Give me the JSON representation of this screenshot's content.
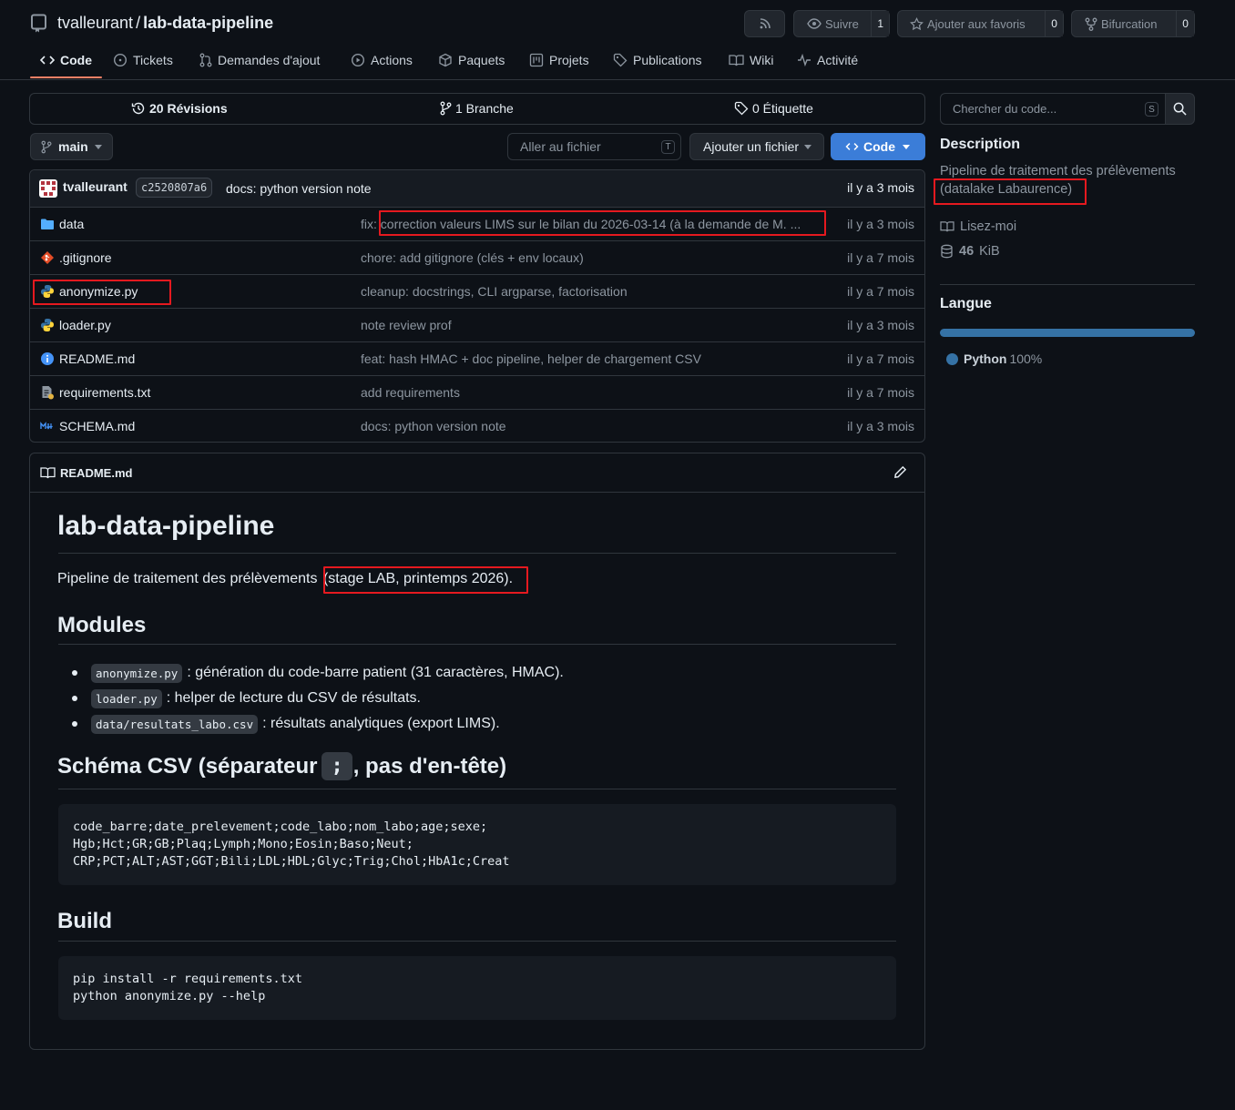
{
  "repo": {
    "owner": "tvalleurant",
    "separator": "/",
    "name": "lab-data-pipeline"
  },
  "header_buttons": {
    "watch_label": "Suivre",
    "watch_count": "1",
    "star_label": "Ajouter aux favoris",
    "star_count": "0",
    "fork_label": "Bifurcation",
    "fork_count": "0"
  },
  "nav": [
    {
      "label": "Code",
      "icon": "code-icon"
    },
    {
      "label": "Tickets",
      "icon": "issue-icon"
    },
    {
      "label": "Demandes d'ajout",
      "icon": "pull-request-icon"
    },
    {
      "label": "Actions",
      "icon": "play-icon"
    },
    {
      "label": "Paquets",
      "icon": "package-icon"
    },
    {
      "label": "Projets",
      "icon": "project-icon"
    },
    {
      "label": "Publications",
      "icon": "tag-icon"
    },
    {
      "label": "Wiki",
      "icon": "book-icon"
    },
    {
      "label": "Activité",
      "icon": "pulse-icon"
    }
  ],
  "stats": {
    "commits": "20 Révisions",
    "branches": "1 Branche",
    "tags": "0 Étiquette"
  },
  "branch": "main",
  "goto_file_placeholder": "Aller au fichier",
  "goto_file_key": "T",
  "add_file_label": "Ajouter un fichier",
  "code_button_label": "Code",
  "latest_commit": {
    "author": "tvalleurant",
    "hash": "c2520807a6",
    "message": "docs: python version note",
    "date": "il y a 3 mois"
  },
  "files": [
    {
      "name": "data",
      "type": "folder",
      "message": "fix: correction valeurs LIMS sur le bilan du 2026-03-14 (à la demande de M. ...",
      "date": "il y a 3 mois"
    },
    {
      "name": ".gitignore",
      "type": "git",
      "message": "chore: add gitignore (clés + env locaux)",
      "date": "il y a 7 mois"
    },
    {
      "name": "anonymize.py",
      "type": "python",
      "message": "cleanup: docstrings, CLI argparse, factorisation",
      "date": "il y a 7 mois"
    },
    {
      "name": "loader.py",
      "type": "python",
      "message": "note review prof",
      "date": "il y a 3 mois"
    },
    {
      "name": "README.md",
      "type": "info",
      "message": "feat: hash HMAC + doc pipeline, helper de chargement CSV",
      "date": "il y a 7 mois"
    },
    {
      "name": "requirements.txt",
      "type": "text",
      "message": "add requirements",
      "date": "il y a 7 mois"
    },
    {
      "name": "SCHEMA.md",
      "type": "markdown",
      "message": "docs: python version note",
      "date": "il y a 3 mois"
    }
  ],
  "readme": {
    "tab_label": "README.md",
    "h1": "lab-data-pipeline",
    "intro_a": "Pipeline de traitement des prélèvements",
    "intro_b": "(stage LAB, printemps 2026).",
    "h2_modules": "Modules",
    "modules": [
      {
        "code": "anonymize.py",
        "text": ": génération du code-barre patient (31 caractères, HMAC)."
      },
      {
        "code": "loader.py",
        "text": ": helper de lecture du CSV de résultats."
      },
      {
        "code": "data/resultats_labo.csv",
        "text": ": résultats analytiques (export LIMS)."
      }
    ],
    "h2_schema_a": "Schéma CSV (séparateur",
    "h2_schema_code": ";",
    "h2_schema_b": ", pas d'en-tête)",
    "schema_lines": [
      "code_barre;date_prelevement;code_labo;nom_labo;age;sexe;",
      "Hgb;Hct;GR;GB;Plaq;Lymph;Mono;Eosin;Baso;Neut;",
      "CRP;PCT;ALT;AST;GGT;Bili;LDL;HDL;Glyc;Trig;Chol;HbA1c;Creat"
    ],
    "h2_build": "Build",
    "build_lines": [
      "pip install -r requirements.txt",
      "python anonymize.py --help"
    ]
  },
  "sidebar": {
    "search_placeholder": "Chercher du code...",
    "search_key": "S",
    "description_title": "Description",
    "description_line1": "Pipeline de traitement des prélèvements",
    "description_line2": "(datalake Labaurence)",
    "readme_link": "Lisez-moi",
    "size_value": "46",
    "size_unit": "KiB",
    "languages_title": "Langue",
    "language_name": "Python",
    "language_percent": "100%",
    "language_share": 1.0,
    "language_color": "#3572A5"
  },
  "colors": {
    "accent_blue": "#1f6feb",
    "highlight_red": "#e5191f",
    "underline_orange": "#f78166"
  }
}
